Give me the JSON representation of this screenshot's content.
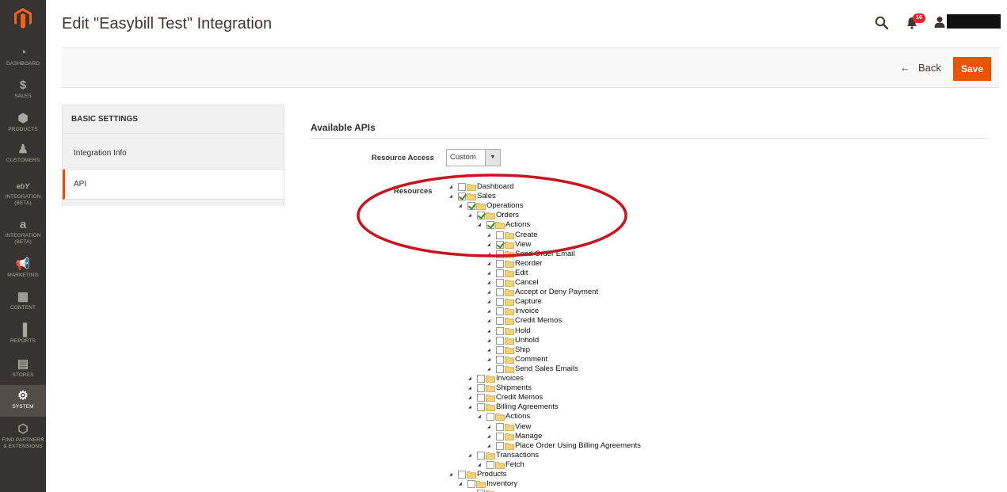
{
  "nav": {
    "items": [
      {
        "label": "DASHBOARD",
        "icon": "dashboard-icon"
      },
      {
        "label": "SALES",
        "icon": "dollar-icon"
      },
      {
        "label": "PRODUCTS",
        "icon": "cube-icon"
      },
      {
        "label": "CUSTOMERS",
        "icon": "person-icon"
      },
      {
        "label": "INTEGRATION (BETA)",
        "icon": "ebay-icon"
      },
      {
        "label": "INTEGRATION (BETA)",
        "icon": "amazon-icon"
      },
      {
        "label": "MARKETING",
        "icon": "megaphone-icon"
      },
      {
        "label": "CONTENT",
        "icon": "content-icon"
      },
      {
        "label": "REPORTS",
        "icon": "bar-chart-icon"
      },
      {
        "label": "STORES",
        "icon": "store-icon"
      },
      {
        "label": "SYSTEM",
        "icon": "gear-icon"
      },
      {
        "label": "FIND PARTNERS & EXTENSIONS",
        "icon": "extensions-icon"
      }
    ]
  },
  "header": {
    "title": "Edit \"Easybill Test\" Integration",
    "notifications_count": "16"
  },
  "actions": {
    "back_label": "Back",
    "save_label": "Save"
  },
  "tabs": {
    "heading": "BASIC SETTINGS",
    "items": [
      {
        "label": "Integration Info"
      },
      {
        "label": "API"
      }
    ]
  },
  "apis": {
    "section_title": "Available APIs",
    "resource_access_label": "Resource Access",
    "resource_access_value": "Custom",
    "resources_label": "Resources"
  },
  "tree": [
    {
      "label": "Dashboard",
      "level": 0,
      "checked": false
    },
    {
      "label": "Sales",
      "level": 0,
      "checked": true
    },
    {
      "label": "Operations",
      "level": 1,
      "checked": true
    },
    {
      "label": "Orders",
      "level": 2,
      "checked": true
    },
    {
      "label": "Actions",
      "level": 3,
      "checked": true
    },
    {
      "label": "Create",
      "level": 4,
      "checked": false
    },
    {
      "label": "View",
      "level": 4,
      "checked": true
    },
    {
      "label": "Send Order Email",
      "level": 4,
      "checked": false
    },
    {
      "label": "Reorder",
      "level": 4,
      "checked": false
    },
    {
      "label": "Edit",
      "level": 4,
      "checked": false
    },
    {
      "label": "Cancel",
      "level": 4,
      "checked": false
    },
    {
      "label": "Accept or Deny Payment",
      "level": 4,
      "checked": false
    },
    {
      "label": "Capture",
      "level": 4,
      "checked": false
    },
    {
      "label": "Invoice",
      "level": 4,
      "checked": false
    },
    {
      "label": "Credit Memos",
      "level": 4,
      "checked": false
    },
    {
      "label": "Hold",
      "level": 4,
      "checked": false
    },
    {
      "label": "Unhold",
      "level": 4,
      "checked": false
    },
    {
      "label": "Ship",
      "level": 4,
      "checked": false
    },
    {
      "label": "Comment",
      "level": 4,
      "checked": false
    },
    {
      "label": "Send Sales Emails",
      "level": 4,
      "checked": false
    },
    {
      "label": "Invoices",
      "level": 2,
      "checked": false
    },
    {
      "label": "Shipments",
      "level": 2,
      "checked": false
    },
    {
      "label": "Credit Memos",
      "level": 2,
      "checked": false
    },
    {
      "label": "Billing Agreements",
      "level": 2,
      "checked": false
    },
    {
      "label": "Actions",
      "level": 3,
      "checked": false
    },
    {
      "label": "View",
      "level": 4,
      "checked": false
    },
    {
      "label": "Manage",
      "level": 4,
      "checked": false
    },
    {
      "label": "Place Order Using Billing Agreements",
      "level": 4,
      "checked": false
    },
    {
      "label": "Transactions",
      "level": 2,
      "checked": false
    },
    {
      "label": "Fetch",
      "level": 3,
      "checked": false
    },
    {
      "label": "Products",
      "level": 0,
      "checked": false
    },
    {
      "label": "Inventory",
      "level": 1,
      "checked": false
    },
    {
      "label": "",
      "level": 2,
      "checked": false
    }
  ],
  "colors": {
    "nav_bg": "#373330",
    "accent": "#eb5202",
    "annotation": "#c8141e",
    "check": "#3c8c1e"
  }
}
